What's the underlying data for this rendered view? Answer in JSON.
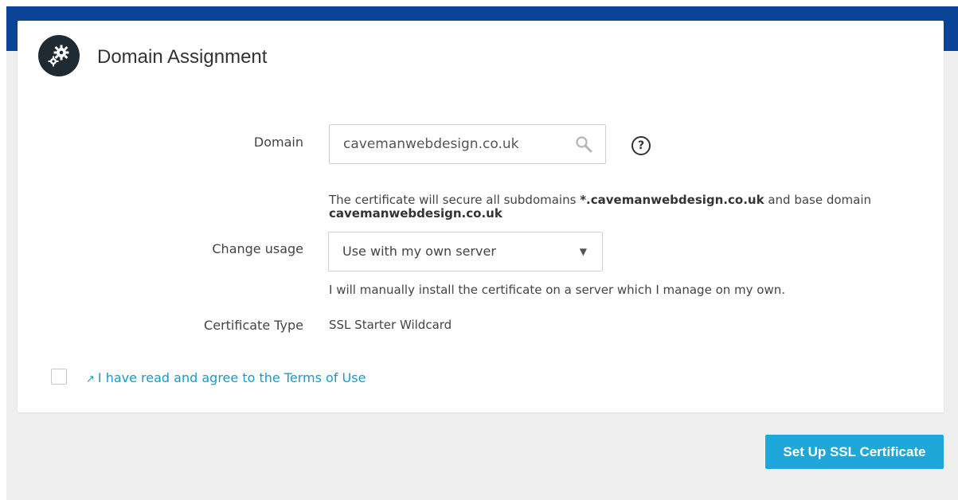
{
  "card": {
    "title": "Domain Assignment",
    "icon": "gears-icon"
  },
  "form": {
    "domain_label": "Domain",
    "domain_value": "cavemanwebdesign.co.uk",
    "help_glyph": "?",
    "info_prefix": "The certificate will secure all subdomains ",
    "info_wildcard": "*.cavemanwebdesign.co.uk",
    "info_middle": " and base domain",
    "info_base": "cavemanwebdesign.co.uk",
    "usage_label": "Change usage",
    "usage_selected": "Use with my own server",
    "usage_help": "I will manually install the certificate on a server which I manage on my own.",
    "cert_type_label": "Certificate Type",
    "cert_type_value": "SSL Starter Wildcard"
  },
  "terms": {
    "checked": false,
    "link_text": "I have read and agree to the Terms of Use"
  },
  "actions": {
    "submit_label": "Set Up SSL Certificate"
  },
  "colors": {
    "header": "#0b4496",
    "accent": "#1ea7d8",
    "link": "#1a9ac9",
    "icon_bg": "#1f2a33"
  }
}
